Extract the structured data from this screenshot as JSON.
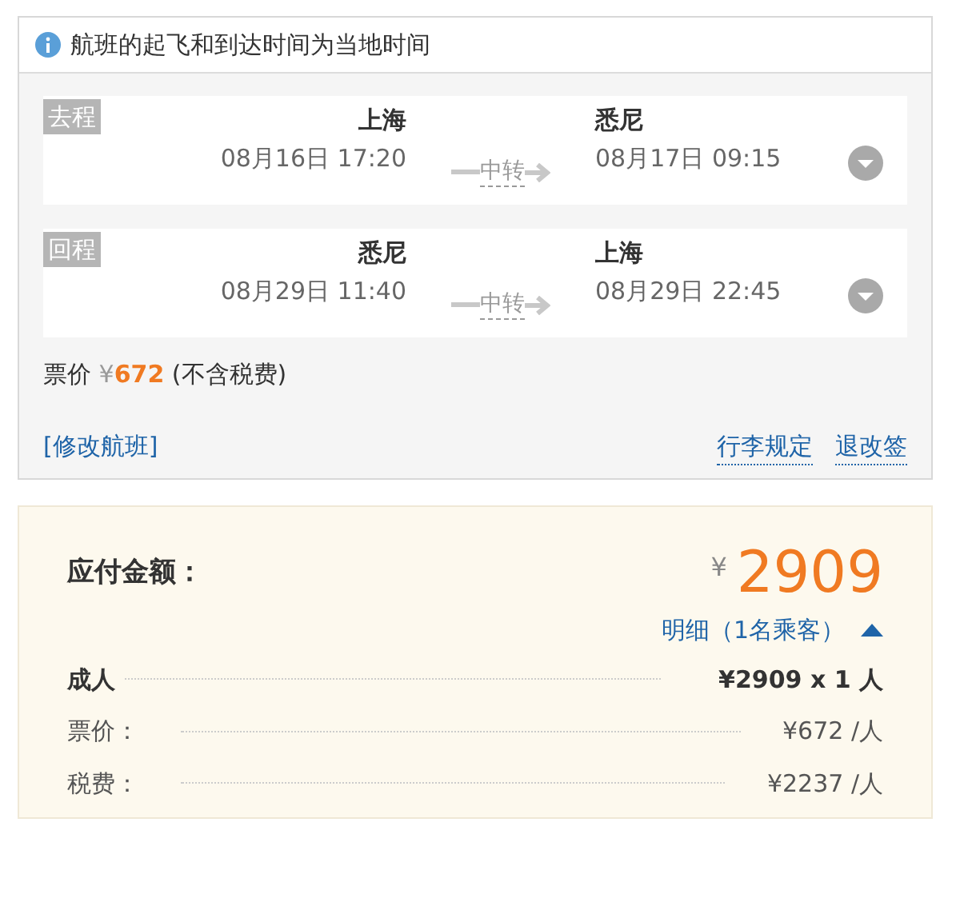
{
  "notice": {
    "text": "航班的起飞和到达时间为当地时间"
  },
  "flights": [
    {
      "tag": "去程",
      "from": {
        "city": "上海",
        "time": "08月16日 17:20"
      },
      "via": "中转",
      "to": {
        "city": "悉尼",
        "time": "08月17日 09:15"
      },
      "expanded": false
    },
    {
      "tag": "回程",
      "from": {
        "city": "悉尼",
        "time": "08月29日 11:40"
      },
      "via": "中转",
      "to": {
        "city": "上海",
        "time": "08月29日 22:45"
      },
      "expanded": false
    }
  ],
  "fare": {
    "label": "票价",
    "currency": "¥",
    "amount": "672",
    "note": "(不含税费)"
  },
  "links": {
    "left": "[修改航班]",
    "right": [
      "行李规定",
      "退改签"
    ]
  },
  "payment": {
    "label": "应付金额：",
    "currency": "¥",
    "amount": "2909",
    "details_link": "明细（1名乘客）",
    "expanded": true,
    "rows": [
      {
        "kind": "total",
        "label": "成人",
        "value": "¥2909 x 1 人"
      },
      {
        "kind": "item",
        "label": "票价：",
        "value": "¥672 /人"
      },
      {
        "kind": "item",
        "label": "税费：",
        "value": "¥2237 /人"
      }
    ]
  }
}
